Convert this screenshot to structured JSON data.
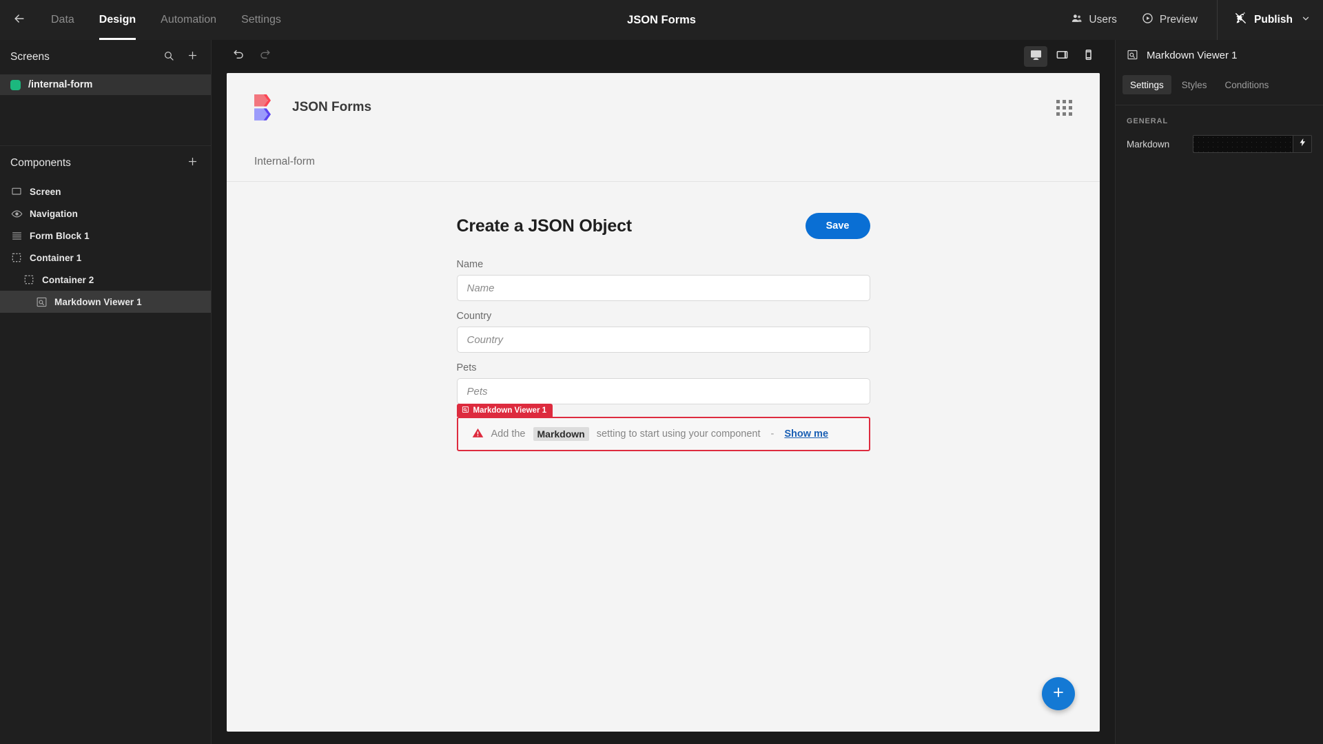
{
  "topbar": {
    "back_icon": "arrow-left-icon",
    "nav": [
      {
        "label": "Data",
        "active": false
      },
      {
        "label": "Design",
        "active": true
      },
      {
        "label": "Automation",
        "active": false
      },
      {
        "label": "Settings",
        "active": false
      }
    ],
    "app_title": "JSON Forms",
    "users_label": "Users",
    "users_icon": "users-icon",
    "preview_label": "Preview",
    "preview_icon": "play-circle-icon",
    "publish_label": "Publish",
    "publish_icon": "rocket-icon",
    "publish_caret_icon": "chevron-down-icon"
  },
  "left_panel": {
    "screens": {
      "title": "Screens",
      "search_icon": "search-icon",
      "add_icon": "plus-icon",
      "items": [
        {
          "label": "/internal-form",
          "selected": true,
          "dot_color": "#1cb87e"
        }
      ]
    },
    "components": {
      "title": "Components",
      "add_icon": "plus-icon",
      "items": [
        {
          "label": "Screen",
          "icon": "screen-icon",
          "depth": 1,
          "selected": false
        },
        {
          "label": "Navigation",
          "icon": "eye-icon",
          "depth": 1,
          "selected": false
        },
        {
          "label": "Form Block 1",
          "icon": "form-block-icon",
          "depth": 1,
          "selected": false
        },
        {
          "label": "Container 1",
          "icon": "container-icon",
          "depth": 1,
          "selected": false
        },
        {
          "label": "Container 2",
          "icon": "container-icon",
          "depth": 2,
          "selected": false
        },
        {
          "label": "Markdown Viewer 1",
          "icon": "markdown-viewer-icon",
          "depth": 3,
          "selected": true
        }
      ]
    }
  },
  "canvas": {
    "toolbar": {
      "undo_icon": "undo-icon",
      "redo_icon": "redo-icon",
      "devices": [
        {
          "name": "desktop",
          "icon": "desktop-icon",
          "active": true
        },
        {
          "name": "tablet",
          "icon": "tablet-icon",
          "active": false
        },
        {
          "name": "mobile",
          "icon": "mobile-icon",
          "active": false
        }
      ]
    },
    "frame": {
      "brand_name": "JSON Forms",
      "brand_logo": "json-forms-logo",
      "apps_icon": "apps-grid-icon",
      "subnav_label": "Internal-form",
      "form": {
        "title": "Create a JSON Object",
        "save_label": "Save",
        "fields": [
          {
            "label": "Name",
            "value": "",
            "placeholder": "Name"
          },
          {
            "label": "Country",
            "value": "",
            "placeholder": "Country"
          },
          {
            "label": "Pets",
            "value": "",
            "placeholder": "Pets"
          }
        ],
        "selected_component": {
          "badge_label": "Markdown Viewer 1",
          "badge_icon": "markdown-viewer-icon",
          "warning_icon": "warning-triangle-icon",
          "message_prefix": "Add the",
          "message_code": "Markdown",
          "message_suffix": "setting to start using your component",
          "separator": "-",
          "link_label": "Show me"
        }
      },
      "fab_icon": "plus-icon"
    }
  },
  "right_panel": {
    "header_icon": "markdown-viewer-icon",
    "header_title": "Markdown Viewer 1",
    "tabs": [
      {
        "label": "Settings",
        "active": true
      },
      {
        "label": "Styles",
        "active": false
      },
      {
        "label": "Conditions",
        "active": false
      }
    ],
    "section_title": "GENERAL",
    "settings": [
      {
        "label": "Markdown",
        "value": "",
        "bind_icon": "lightning-bolt-icon"
      }
    ]
  },
  "colors": {
    "accent_blue": "#0a6fd4",
    "error_red": "#dd2b3e",
    "screen_dot_green": "#1cb87e",
    "panel_bg": "#1f1f1f",
    "canvas_bg": "#1b1b1b",
    "frame_bg": "#f4f4f4"
  }
}
